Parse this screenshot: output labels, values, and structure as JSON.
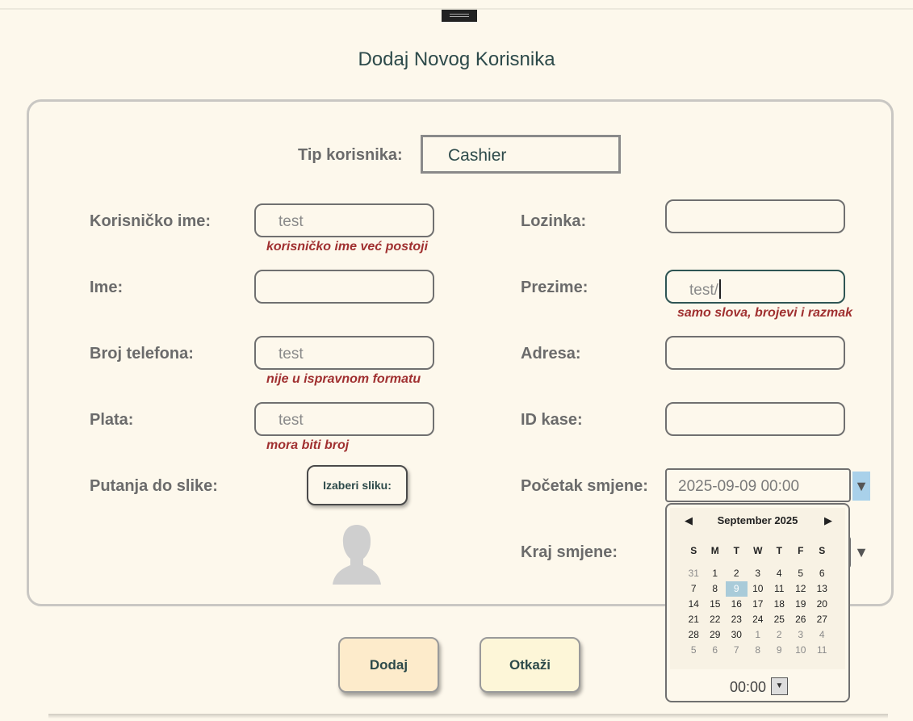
{
  "dialog": {
    "title": "Dodaj Novog Korisnika",
    "user_type_label": "Tip korisnika:",
    "user_type_value": "Cashier"
  },
  "fields": {
    "username": {
      "label": "Korisničko ime:",
      "value": "test",
      "error": "korisničko ime već postoji"
    },
    "password": {
      "label": "Lozinka:",
      "value": ""
    },
    "first_name": {
      "label": "Ime:",
      "value": ""
    },
    "last_name": {
      "label": "Prezime:",
      "value": "test/",
      "error": "samo slova, brojevi i razmak"
    },
    "phone": {
      "label": "Broj telefona:",
      "value": "test",
      "error": "nije u ispravnom formatu"
    },
    "address": {
      "label": "Adresa:",
      "value": ""
    },
    "salary": {
      "label": "Plata:",
      "value": "test",
      "error": "mora biti broj"
    },
    "register_id": {
      "label": "ID kase:",
      "value": ""
    },
    "image_path": {
      "label": "Putanja do slike:",
      "button": "Izaberi sliku:"
    },
    "shift_start": {
      "label": "Početak smjene:",
      "value": "2025-09-09 00:00"
    },
    "shift_end": {
      "label": "Kraj smjene:"
    }
  },
  "calendar": {
    "month": "September 2025",
    "weekdays": [
      "S",
      "M",
      "T",
      "W",
      "T",
      "F",
      "S"
    ],
    "weeks": [
      [
        "31",
        "1",
        "2",
        "3",
        "4",
        "5",
        "6"
      ],
      [
        "7",
        "8",
        "9",
        "10",
        "11",
        "12",
        "13"
      ],
      [
        "14",
        "15",
        "16",
        "17",
        "18",
        "19",
        "20"
      ],
      [
        "21",
        "22",
        "23",
        "24",
        "25",
        "26",
        "27"
      ],
      [
        "28",
        "29",
        "30",
        "1",
        "2",
        "3",
        "4"
      ],
      [
        "5",
        "6",
        "7",
        "8",
        "9",
        "10",
        "11"
      ]
    ],
    "selected_day": "9",
    "time": "00:00"
  },
  "actions": {
    "add": "Dodaj",
    "cancel": "Otkaži"
  },
  "colors": {
    "background": "#fdf8ec",
    "error": "#a03030",
    "add_button": "#fdebcb",
    "cancel_button": "#fdf6d8",
    "selected_day": "#a9cbd9"
  }
}
